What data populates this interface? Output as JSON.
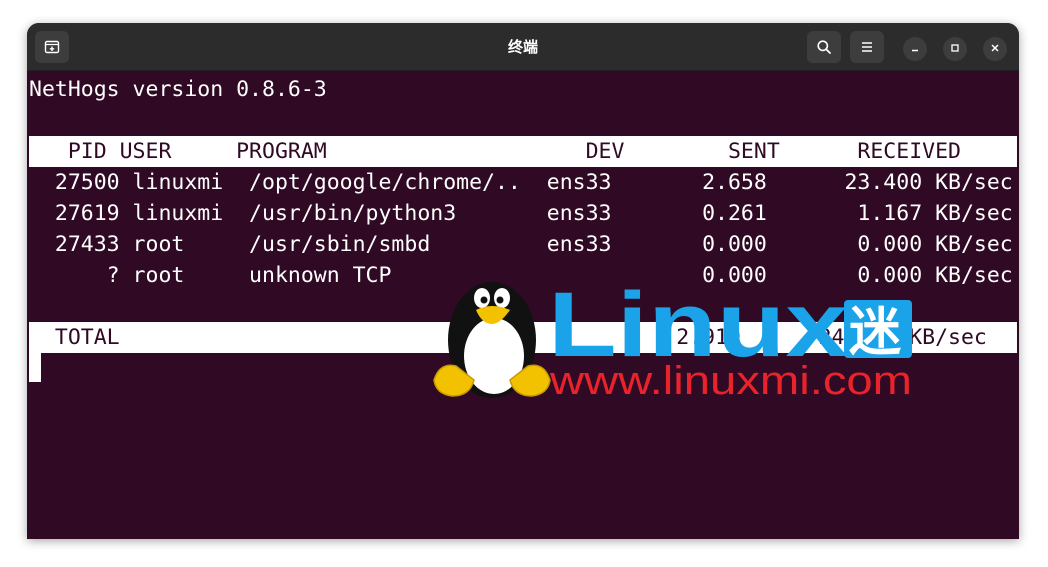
{
  "window": {
    "title": "终端"
  },
  "headerbar": {
    "new_tab_icon": "new-tab-icon",
    "search_icon": "search-icon",
    "menu_icon": "hamburger-menu-icon",
    "minimize_icon": "minimize-icon",
    "maximize_icon": "maximize-icon",
    "close_icon": "close-icon"
  },
  "terminal": {
    "version_line": "NetHogs version 0.8.6-3",
    "header_row": "   PID USER     PROGRAM                    DEV        SENT      RECEIVED       ",
    "rows": [
      "  27500 linuxmi  /opt/google/chrome/..  ens33       2.658      23.400 KB/sec",
      "  27619 linuxmi  /usr/bin/python3       ens33       0.261       1.167 KB/sec",
      "  27433 root     /usr/sbin/smbd         ens33       0.000       0.000 KB/sec",
      "      ? root     unknown TCP                        0.000       0.000 KB/sec"
    ],
    "total_row": "  TOTAL                                           2.919      24.566 KB/sec"
  },
  "watermark": {
    "brand": "Linux",
    "brand_char": "迷",
    "url": "www.linuxmi.com"
  },
  "colors": {
    "terminal_bg": "#300a24",
    "terminal_fg": "#ffffff",
    "header_bg": "#2c2c2c",
    "watermark_blue": "#1aa3e8",
    "watermark_red": "#e8232b"
  }
}
